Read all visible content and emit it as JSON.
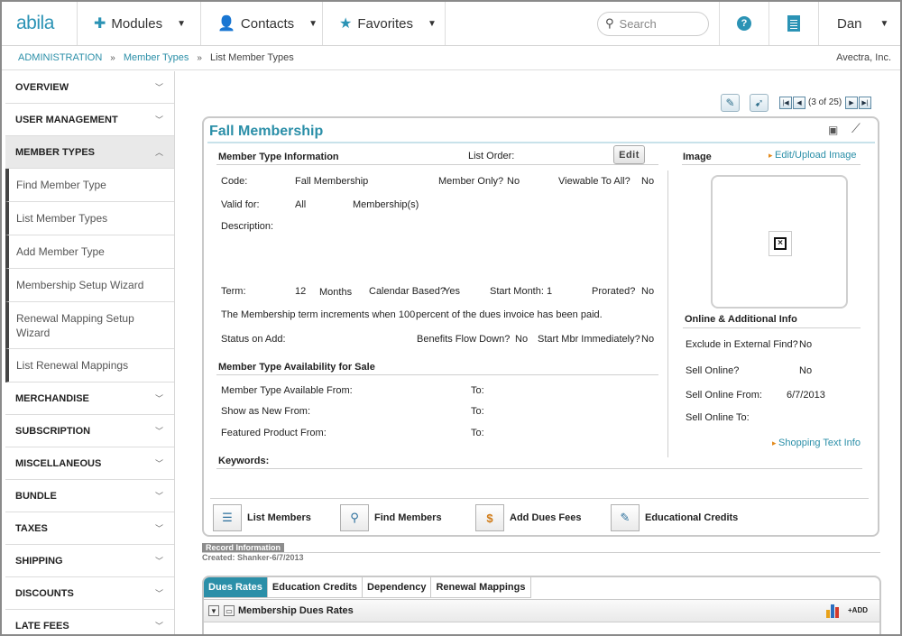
{
  "nav": {
    "logo": "abila",
    "modules": "Modules",
    "contacts": "Contacts",
    "favorites": "Favorites",
    "search_placeholder": "Search",
    "user": "Dan",
    "help_icon": "question-circle-icon",
    "org_icon": "building-icon",
    "accent": "#2b93b5"
  },
  "breadcrumb": {
    "root": "ADMINISTRATION",
    "section": "Member Types",
    "current": "List Member Types",
    "company": "Avectra, Inc."
  },
  "sidebar": {
    "sections": [
      {
        "label": "OVERVIEW"
      },
      {
        "label": "USER MANAGEMENT"
      },
      {
        "label": "MEMBER TYPES",
        "open": true
      }
    ],
    "items": [
      {
        "label": "Find Member Type"
      },
      {
        "label": "List Member Types"
      },
      {
        "label": "Add Member Type"
      },
      {
        "label": "Membership Setup Wizard"
      },
      {
        "label": "Renewal Mapping Setup Wizard"
      },
      {
        "label": "List Renewal Mappings"
      }
    ],
    "sections_after": [
      {
        "label": "MERCHANDISE"
      },
      {
        "label": "SUBSCRIPTION"
      },
      {
        "label": "MISCELLANEOUS"
      },
      {
        "label": "BUNDLE"
      },
      {
        "label": "TAXES"
      },
      {
        "label": "SHIPPING"
      },
      {
        "label": "DISCOUNTS"
      },
      {
        "label": "LATE FEES"
      }
    ]
  },
  "pager": {
    "text": "(3 of 25)"
  },
  "detail": {
    "title": "Fall Membership",
    "info_header": "Member Type Information",
    "list_order_label": "List Order:",
    "edit_label": "Edit",
    "code_label": "Code:",
    "code_value": "Fall Membership",
    "member_only_label": "Member Only?",
    "member_only_value": "No",
    "viewable_label": "Viewable To All?",
    "viewable_value": "No",
    "valid_for_label": "Valid for:",
    "valid_for_value": "All",
    "valid_for_unit": "Membership(s)",
    "description_label": "Description:",
    "term_label": "Term:",
    "term_value": "12",
    "term_unit": "Months",
    "calendar_label": "Calendar Based?",
    "calendar_value": "Yes",
    "start_month_label": "Start Month:",
    "start_month_value": "1",
    "prorated_label": "Prorated?",
    "prorated_value": "No",
    "increment_text_a": "The Membership term increments when 100",
    "increment_text_b": "percent of the dues invoice has been paid.",
    "status_label": "Status on Add:",
    "benefits_label": "Benefits Flow Down?",
    "benefits_value": "No",
    "start_mbr_label": "Start Mbr Immediately?",
    "start_mbr_value": "No",
    "avail_header": "Member Type Availability for Sale",
    "avail_from_label": "Member Type Available From:",
    "to_label": "To:",
    "show_new_label": "Show as New From:",
    "featured_label": "Featured Product From:",
    "keywords_label": "Keywords:",
    "image_header": "Image",
    "edit_image_link": "Edit/Upload Image",
    "online_header": "Online & Additional Info",
    "exclude_label": "Exclude in External Find?",
    "exclude_value": "No",
    "sell_online_label": "Sell Online?",
    "sell_online_value": "No",
    "sell_from_label": "Sell Online From:",
    "sell_from_value": "6/7/2013",
    "sell_to_label": "Sell Online To:",
    "shopping_link": "Shopping Text Info"
  },
  "actions": [
    {
      "label": "List Members",
      "icon": "list-members-icon"
    },
    {
      "label": "Find Members",
      "icon": "find-members-icon"
    },
    {
      "label": "Add Dues Fees",
      "icon": "add-dues-icon"
    },
    {
      "label": "Educational Credits",
      "icon": "education-icon"
    }
  ],
  "record": {
    "header": "Record Information",
    "created": "Created: Shanker-6/7/2013"
  },
  "tabs": [
    {
      "label": "Dues Rates",
      "active": true
    },
    {
      "label": "Education Credits"
    },
    {
      "label": "Dependency"
    },
    {
      "label": "Renewal Mappings"
    }
  ],
  "subgrid": {
    "title": "Membership Dues Rates",
    "add_label": "+ADD"
  }
}
